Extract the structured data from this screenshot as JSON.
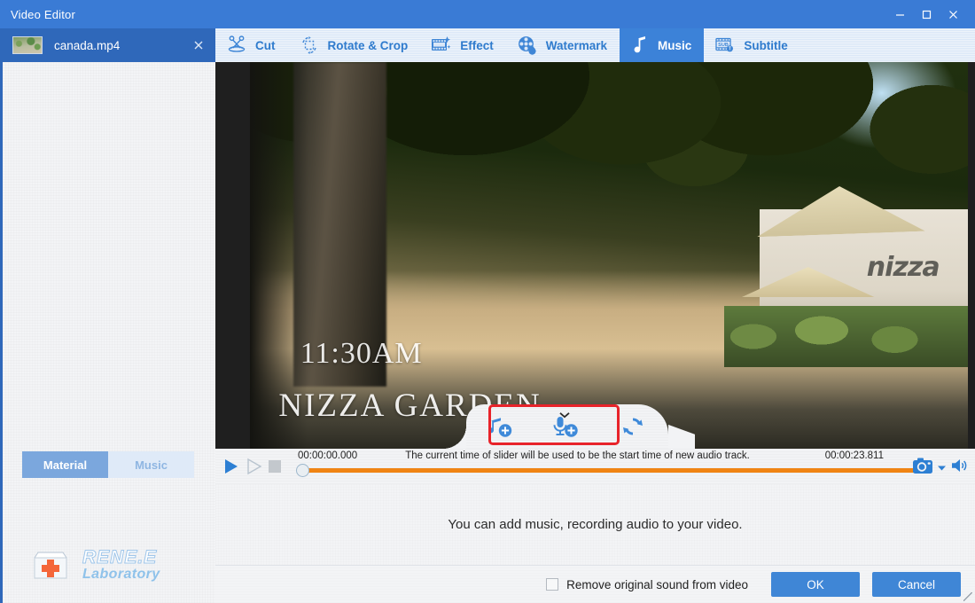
{
  "window": {
    "title": "Video Editor",
    "controls": [
      {
        "name": "minimize-button",
        "glyph": "minimize"
      },
      {
        "name": "maximize-button",
        "glyph": "maximize"
      },
      {
        "name": "close-button",
        "glyph": "close"
      }
    ]
  },
  "file_tab": {
    "label": "canada.mp4",
    "close_glyph": "✕",
    "thumbnail_name": "video-thumbnail"
  },
  "toolbar": {
    "items": [
      {
        "label": "Cut",
        "icon": "scissors-icon",
        "active": false
      },
      {
        "label": "Rotate & Crop",
        "icon": "rotate-crop-icon",
        "active": false
      },
      {
        "label": "Effect",
        "icon": "film-sparkle-icon",
        "active": false
      },
      {
        "label": "Watermark",
        "icon": "film-reel-drop-icon",
        "active": false
      },
      {
        "label": "Music",
        "icon": "music-note-icon",
        "active": true
      },
      {
        "label": "Subtitle",
        "icon": "subtitle-icon",
        "active": false
      }
    ]
  },
  "sidebar": {
    "tabs": [
      {
        "label": "Material",
        "active": true
      },
      {
        "label": "Music",
        "active": false
      }
    ],
    "brand": {
      "name": "RENE.E",
      "sub": "Laboratory",
      "logo_name": "rene-e-logo"
    }
  },
  "preview": {
    "overlay_time": "11:30AM",
    "overlay_title": "NIZZA GARDEN",
    "wall_sign": "nizza"
  },
  "music_pill": {
    "highlighted": true,
    "highlight_color": "#e8232a",
    "buttons": [
      {
        "name": "add-music-button",
        "icon": "music-note-plus-icon"
      },
      {
        "name": "add-recording-button",
        "icon": "microphone-plus-icon"
      },
      {
        "name": "reset-audio-button",
        "icon": "refresh-icon"
      }
    ],
    "chevron": "⌄"
  },
  "transport": {
    "play_label": "play-button",
    "step_label": "step-button",
    "stop_label": "stop-button",
    "current_time": "00:00:00.000",
    "total_time": "00:00:23.811",
    "hint": "The current time of slider will be used to be the start time of new audio track.",
    "progress_color": "#f08413",
    "progress_percent": 0,
    "snapshot_icon": "camera-icon",
    "snapshot_dropdown": "▾",
    "volume_icon": "speaker-icon"
  },
  "message": {
    "text": "You can add music, recording audio to your video."
  },
  "footer": {
    "checkbox_label": "Remove original sound from video",
    "checkbox_checked": false,
    "ok_label": "OK",
    "cancel_label": "Cancel",
    "accent_color": "#3f86d6"
  }
}
